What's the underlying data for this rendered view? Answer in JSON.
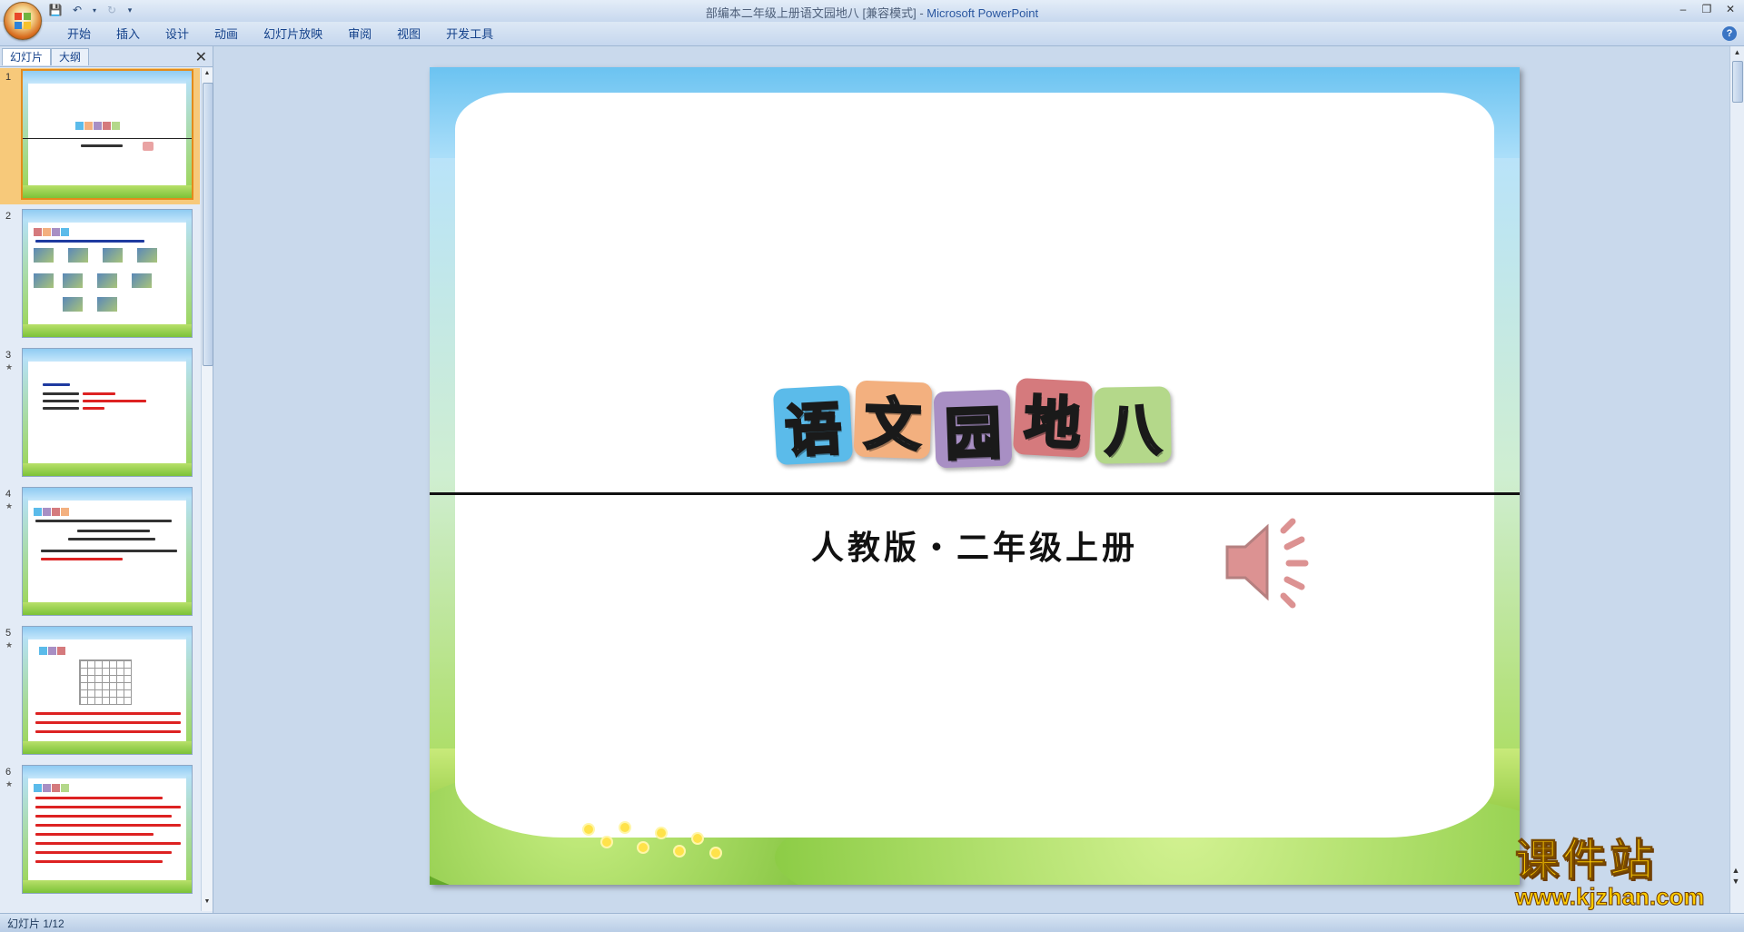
{
  "window": {
    "doc_title": "部编本二年级上册语文园地八 [兼容模式]",
    "separator": " - ",
    "app_name": "Microsoft PowerPoint"
  },
  "ribbon": {
    "tabs": [
      "开始",
      "插入",
      "设计",
      "动画",
      "幻灯片放映",
      "审阅",
      "视图",
      "开发工具"
    ]
  },
  "left_pane": {
    "tabs": [
      "幻灯片",
      "大纲"
    ],
    "active_tab": 0,
    "slides": [
      {
        "num": "1",
        "selected": true
      },
      {
        "num": "2",
        "selected": false
      },
      {
        "num": "3",
        "selected": false
      },
      {
        "num": "4",
        "selected": false
      },
      {
        "num": "5",
        "selected": false
      },
      {
        "num": "6",
        "selected": false
      }
    ]
  },
  "slide": {
    "title_chars": [
      "语",
      "文",
      "园",
      "地",
      "八"
    ],
    "tile_colors": [
      "#5bbbea",
      "#f3b07f",
      "#a88fc4",
      "#d57a7d",
      "#b4d88a"
    ],
    "subtitle": "人教版・二年级上册",
    "speaker_icon": "speaker-icon"
  },
  "watermark": {
    "brand": "课件站",
    "url": "www.kjzhan.com"
  },
  "status": {
    "slide_indicator": "幻灯片 1/12"
  }
}
